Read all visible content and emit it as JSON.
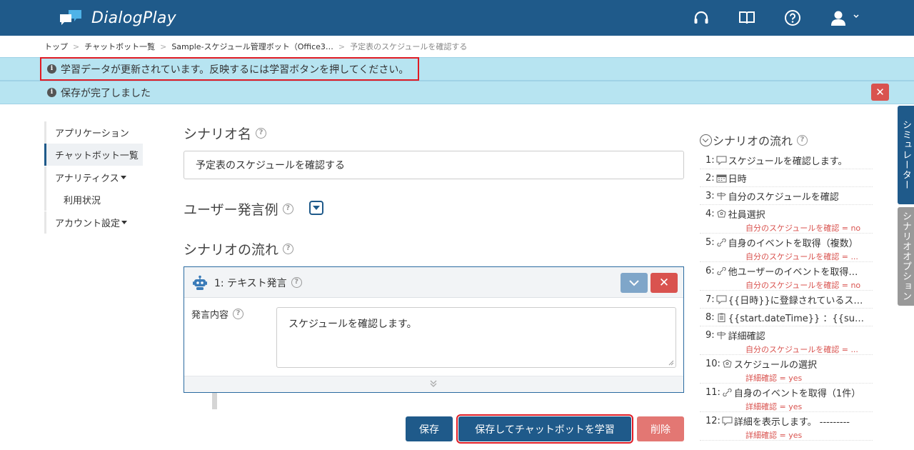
{
  "header": {
    "app_name": "DialogPlay",
    "icons": [
      "headset-icon",
      "book-icon",
      "help-icon",
      "user-icon"
    ]
  },
  "breadcrumb": [
    "トップ",
    "チャットボット一覧",
    "Sample-スケジュール管理ボット（Office3…",
    "予定表のスケジュールを確認する"
  ],
  "alerts": {
    "learning": "学習データが更新されています。反映するには学習ボタンを押してください。",
    "saved": "保存が完了しました"
  },
  "nav": {
    "items": [
      "アプリケーション",
      "チャットボット一覧",
      "アナリティクス",
      "利用状況",
      "アカウント設定"
    ]
  },
  "main": {
    "scenario_name_label": "シナリオ名",
    "scenario_name_value": "予定表のスケジュールを確認する",
    "user_examples_label": "ユーザー発言例",
    "flow_label": "シナリオの流れ",
    "card": {
      "title": "1: テキスト発言",
      "field_label": "発言内容",
      "field_value": "スケジュールを確認します。"
    },
    "buttons": {
      "save": "保存",
      "save_learn": "保存してチャットボットを学習",
      "delete": "削除"
    }
  },
  "flow": {
    "title": "シナリオの流れ",
    "items": [
      {
        "num": "1:",
        "icon": "speech-icon",
        "label": "スケジュールを確認します。",
        "cond": ""
      },
      {
        "num": "2:",
        "icon": "calendar-icon",
        "label": "日時",
        "cond": ""
      },
      {
        "num": "3:",
        "icon": "signpost-icon",
        "label": "自分のスケジュールを確認",
        "cond": ""
      },
      {
        "num": "4:",
        "icon": "badge-icon",
        "label": "社員選択",
        "cond": "自分のスケジュールを確認 = no"
      },
      {
        "num": "5:",
        "icon": "link-icon",
        "label": "自身のイベントを取得（複数）",
        "cond": "自分のスケジュールを確認 = ..."
      },
      {
        "num": "6:",
        "icon": "link-icon",
        "label": "他ユーザーのイベントを取得…",
        "cond": "自分のスケジュールを確認 = no"
      },
      {
        "num": "7:",
        "icon": "speech-icon",
        "label": "{{日時}}に登録されているス…",
        "cond": ""
      },
      {
        "num": "8:",
        "icon": "clipboard-icon",
        "label": "{{start.dateTime}} ：{{su…",
        "cond": ""
      },
      {
        "num": "9:",
        "icon": "signpost-icon",
        "label": "詳細確認",
        "cond": "自分のスケジュールを確認 = ..."
      },
      {
        "num": "10:",
        "icon": "badge-icon",
        "label": "スケジュールの選択",
        "cond": "詳細確認 = yes"
      },
      {
        "num": "11:",
        "icon": "link-icon",
        "label": "自身のイベントを取得（1件）",
        "cond": "詳細確認 = yes"
      },
      {
        "num": "12:",
        "icon": "speech-icon",
        "label": "詳細を表示します。 ---------",
        "cond": "詳細確認 = yes"
      }
    ]
  },
  "side_tabs": {
    "simulator": "シミュレーター",
    "options": "シナリオオプション"
  },
  "colors": {
    "brand": "#1f5a8a",
    "alert_bg": "#b7e4f1",
    "danger": "#d9534f",
    "highlight": "#e01b24"
  }
}
